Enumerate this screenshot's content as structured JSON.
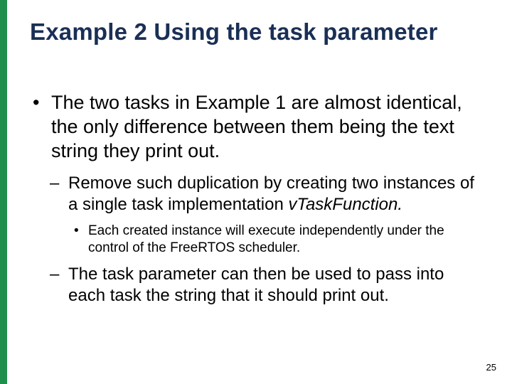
{
  "slide": {
    "title": "Example 2 Using the task parameter",
    "page_number": "25"
  },
  "bullets": {
    "b1": "The two tasks in Example 1 are almost identical, the only difference between them being the text string they print out.",
    "b2a": "Remove such duplication by creating two instances of a single task implementation ",
    "b2b": "vTaskFunction.",
    "b3": "Each created instance will execute independently under the control of the FreeRTOS scheduler.",
    "b4": "The task parameter can then be used to pass into each task the string that it should print out."
  }
}
